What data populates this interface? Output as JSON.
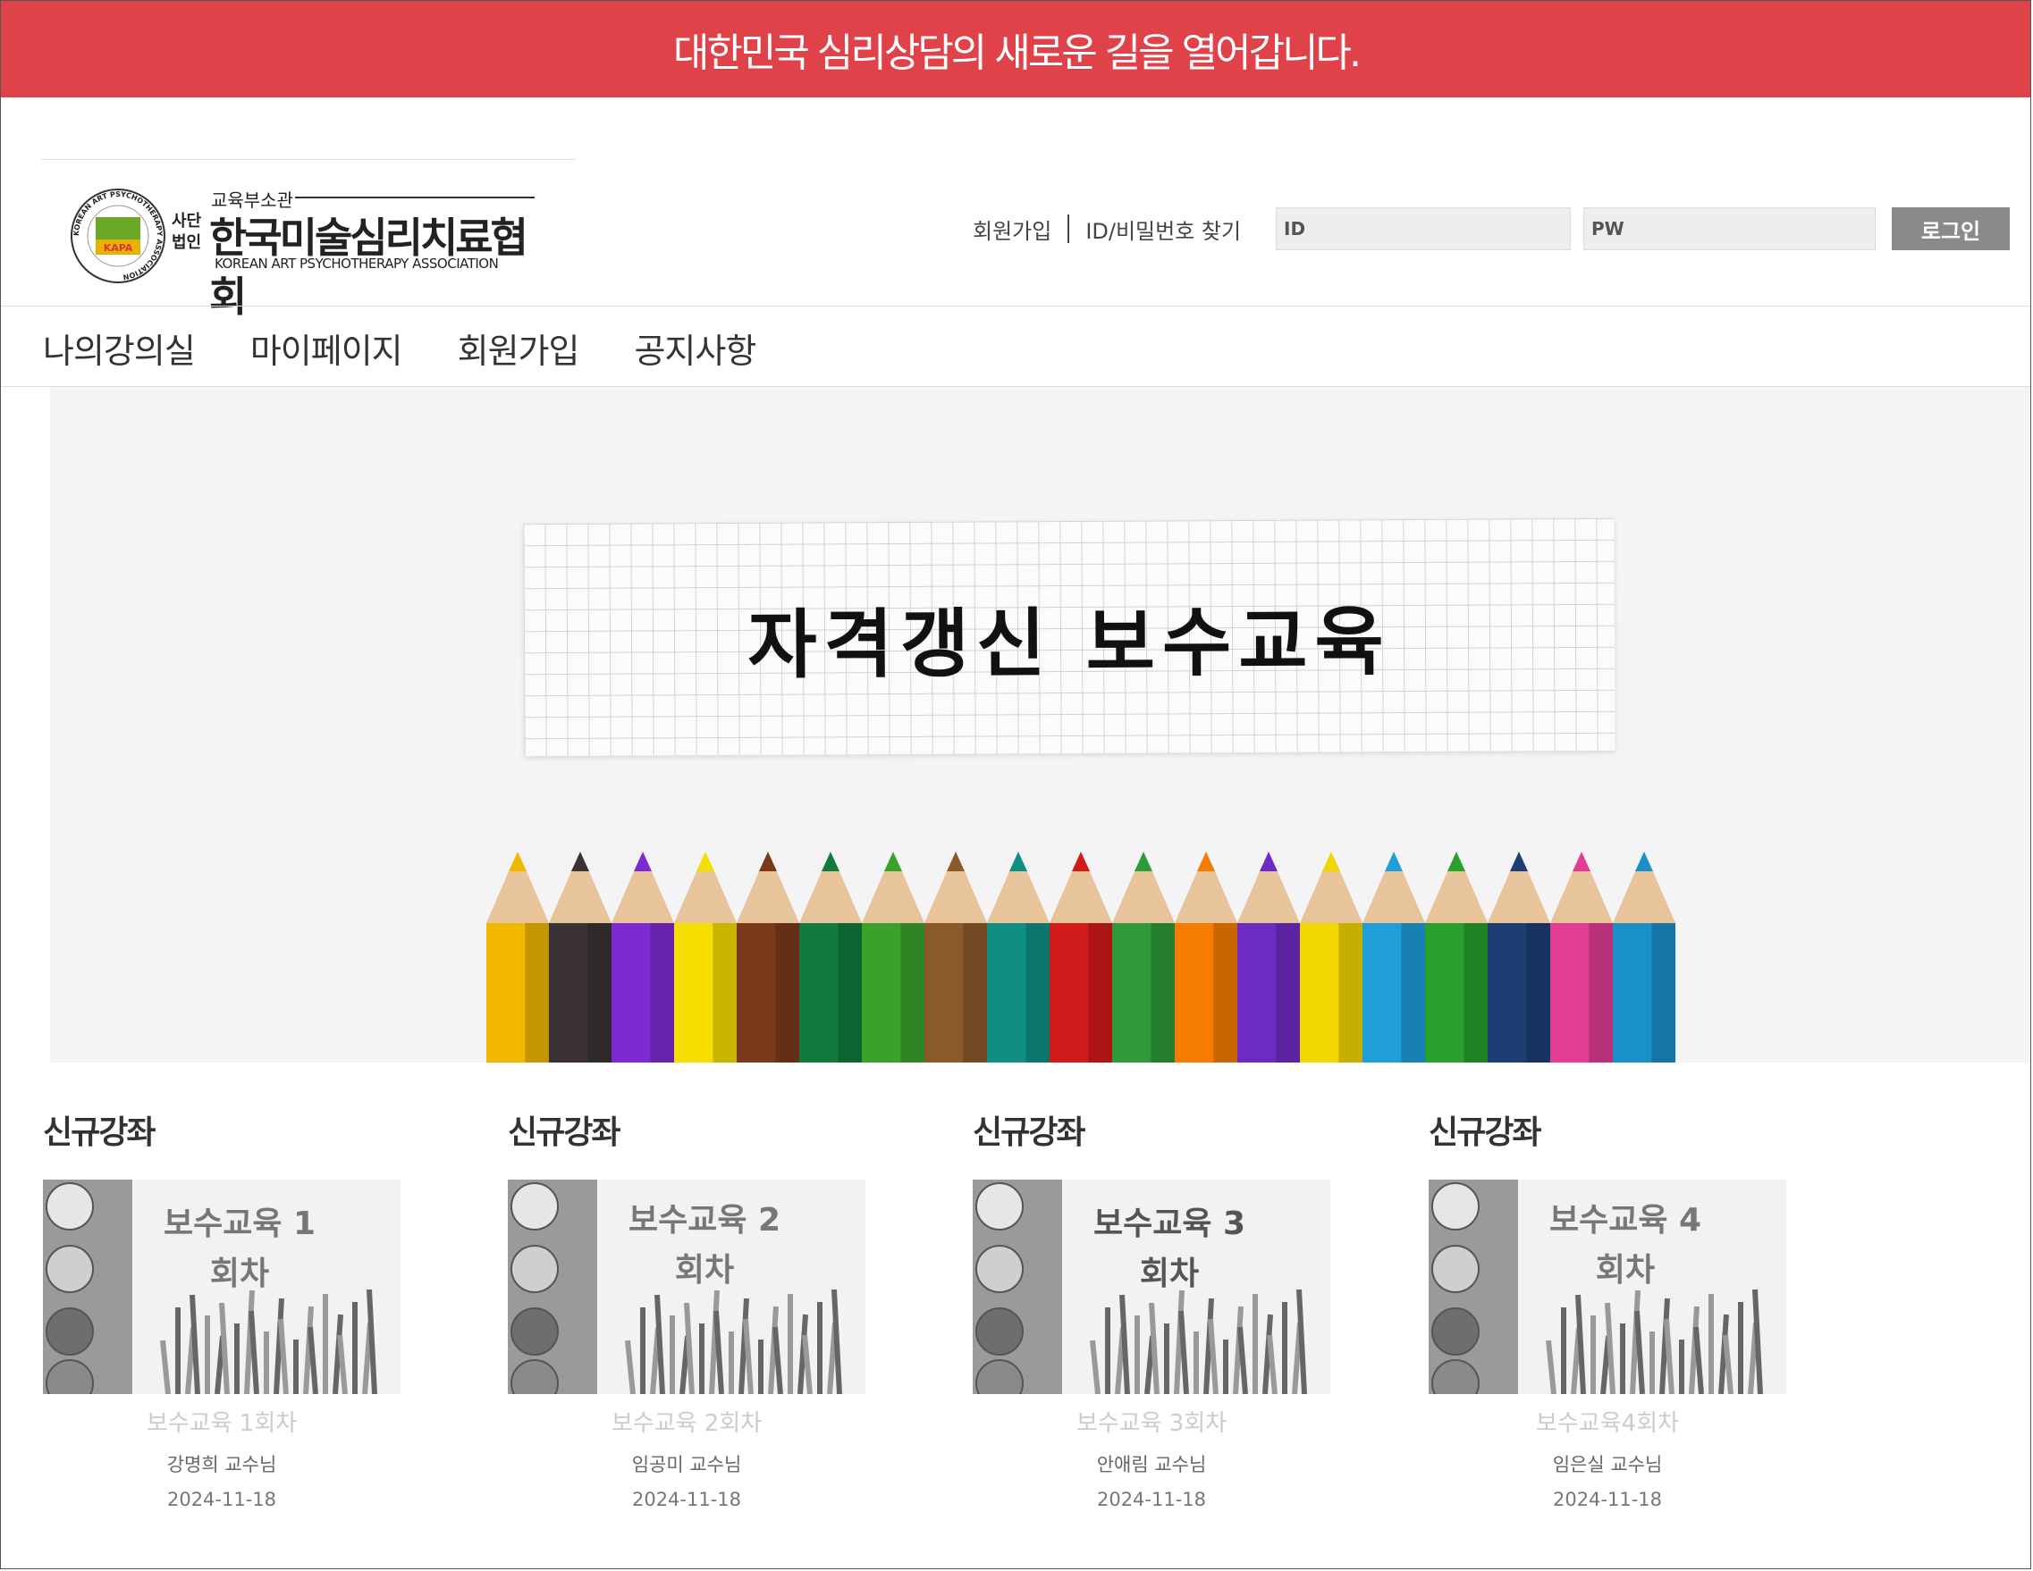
{
  "banner": {
    "text": "대한민국 심리상담의 새로운 길을 열어갑니다."
  },
  "logo": {
    "pre": "교육부소관",
    "corp": "사단법인",
    "name": "한국미술심리치료협회",
    "english": "KOREAN ART PSYCHOTHERAPY ASSOCIATION",
    "seal_text": "KOREAN ART PSYCHOTHERAPY ASSOCIATION",
    "seal_abbr": "KAPA"
  },
  "auth": {
    "join": "회원가입",
    "find": "ID/비밀번호 찾기",
    "id_placeholder": "ID",
    "pw_placeholder": "PW",
    "login": "로그인"
  },
  "nav": [
    "나의강의실",
    "마이페이지",
    "회원가입",
    "공지사항"
  ],
  "hero": {
    "title": "자격갱신 보수교육",
    "pencil_colors": [
      "#f2b800",
      "#3a3234",
      "#7d2ad0",
      "#f5de00",
      "#7a3a1a",
      "#127a3c",
      "#3aa12b",
      "#8b5a2b",
      "#0f8f84",
      "#d11a1a",
      "#2f9a3a",
      "#f57c00",
      "#6e2bc4",
      "#f2d600",
      "#1f9ed8",
      "#27a02c",
      "#1d3d73",
      "#e23c93",
      "#1990c8"
    ]
  },
  "courses": [
    {
      "label": "신규강좌",
      "thumb_title": "보수교육 1회차",
      "title": "보수교육 1회차",
      "prof": "강명희 교수님",
      "date": "2024-11-18"
    },
    {
      "label": "신규강좌",
      "thumb_title": "보수교육 2회차",
      "title": "보수교육 2회차",
      "prof": "임공미 교수님",
      "date": "2024-11-18"
    },
    {
      "label": "신규강좌",
      "thumb_title": "보수교육 3회차",
      "title": "보수교육 3회차",
      "prof": "안애림 교수님",
      "date": "2024-11-18"
    },
    {
      "label": "신규강좌",
      "thumb_title": "보수교육 4회차",
      "title": "보수교육4회차",
      "prof": "임은실 교수님",
      "date": "2024-11-18"
    }
  ]
}
